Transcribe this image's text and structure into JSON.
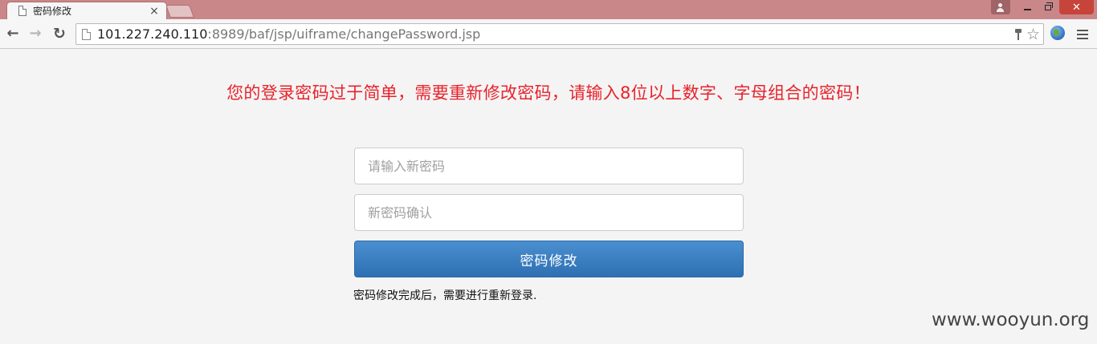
{
  "tab": {
    "title": "密码修改",
    "close_glyph": "×"
  },
  "window": {
    "close_glyph": "✕"
  },
  "toolbar": {
    "back_glyph": "←",
    "forward_glyph": "→",
    "reload_glyph": "↻",
    "url_host": "101.227.240.110",
    "url_rest": ":8989/baf/jsp/uiframe/changePassword.jsp",
    "star_glyph": "☆"
  },
  "icons": [
    "page-icon",
    "key-icon",
    "star-icon",
    "globe-icon",
    "menu-icon",
    "user-icon"
  ],
  "page": {
    "warning": "您的登录密码过于简单，需要重新修改密码，请输入8位以上数字、字母组合的密码！",
    "new_password_placeholder": "请输入新密码",
    "confirm_password_placeholder": "新密码确认",
    "submit_label": "密码修改",
    "note": "密码修改完成后，需要进行重新登录.",
    "watermark": "www.wooyun.org"
  },
  "colors": {
    "titlebar": "#c9878a",
    "warning_text": "#e8232b",
    "button_blue": "#3a7fc1",
    "window_close": "#c7443a"
  }
}
